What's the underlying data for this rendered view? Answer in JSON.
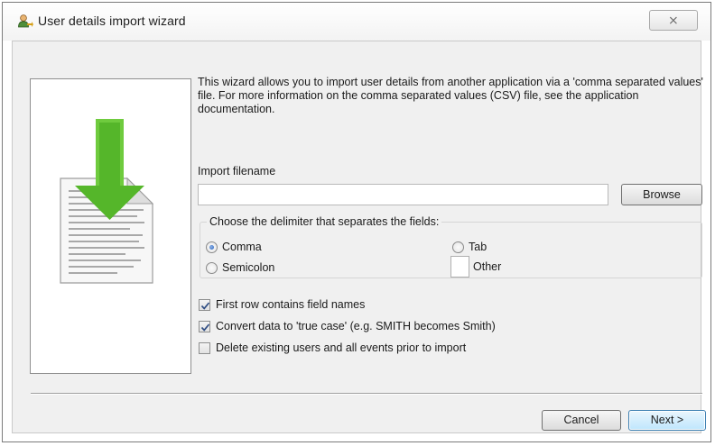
{
  "window": {
    "title": "User details import wizard",
    "close_glyph": "⨯"
  },
  "icons": {
    "title_icon": "user-import-icon",
    "side_art": "import-document-arrow-icon",
    "close": "close-icon"
  },
  "intro_text": "This wizard allows you to import user details from another application via a 'comma separated values' file. For more information on the comma separated values (CSV) file, see the application documentation.",
  "import_file": {
    "label": "Import filename",
    "value": "",
    "placeholder": "",
    "browse_label": "Browse"
  },
  "delimiter": {
    "legend": "Choose the delimiter that separates the fields:",
    "options": [
      {
        "label": "Comma",
        "checked": true
      },
      {
        "label": "Tab",
        "checked": false
      },
      {
        "label": "Semicolon",
        "checked": false
      },
      {
        "label": "Other",
        "checked": false
      }
    ],
    "other_value": ""
  },
  "options": [
    {
      "label": "First row contains field names",
      "checked": true
    },
    {
      "label": "Convert data to 'true case' (e.g. SMITH becomes Smith)",
      "checked": true
    },
    {
      "label": "Delete existing users and all events prior to import",
      "checked": false
    }
  ],
  "buttons": {
    "cancel": "Cancel",
    "next": "Next >"
  },
  "colors": {
    "arrow_green": "#55b62a",
    "dialog_background": "#f0f0f0",
    "default_button_border": "#3c7fb1"
  }
}
